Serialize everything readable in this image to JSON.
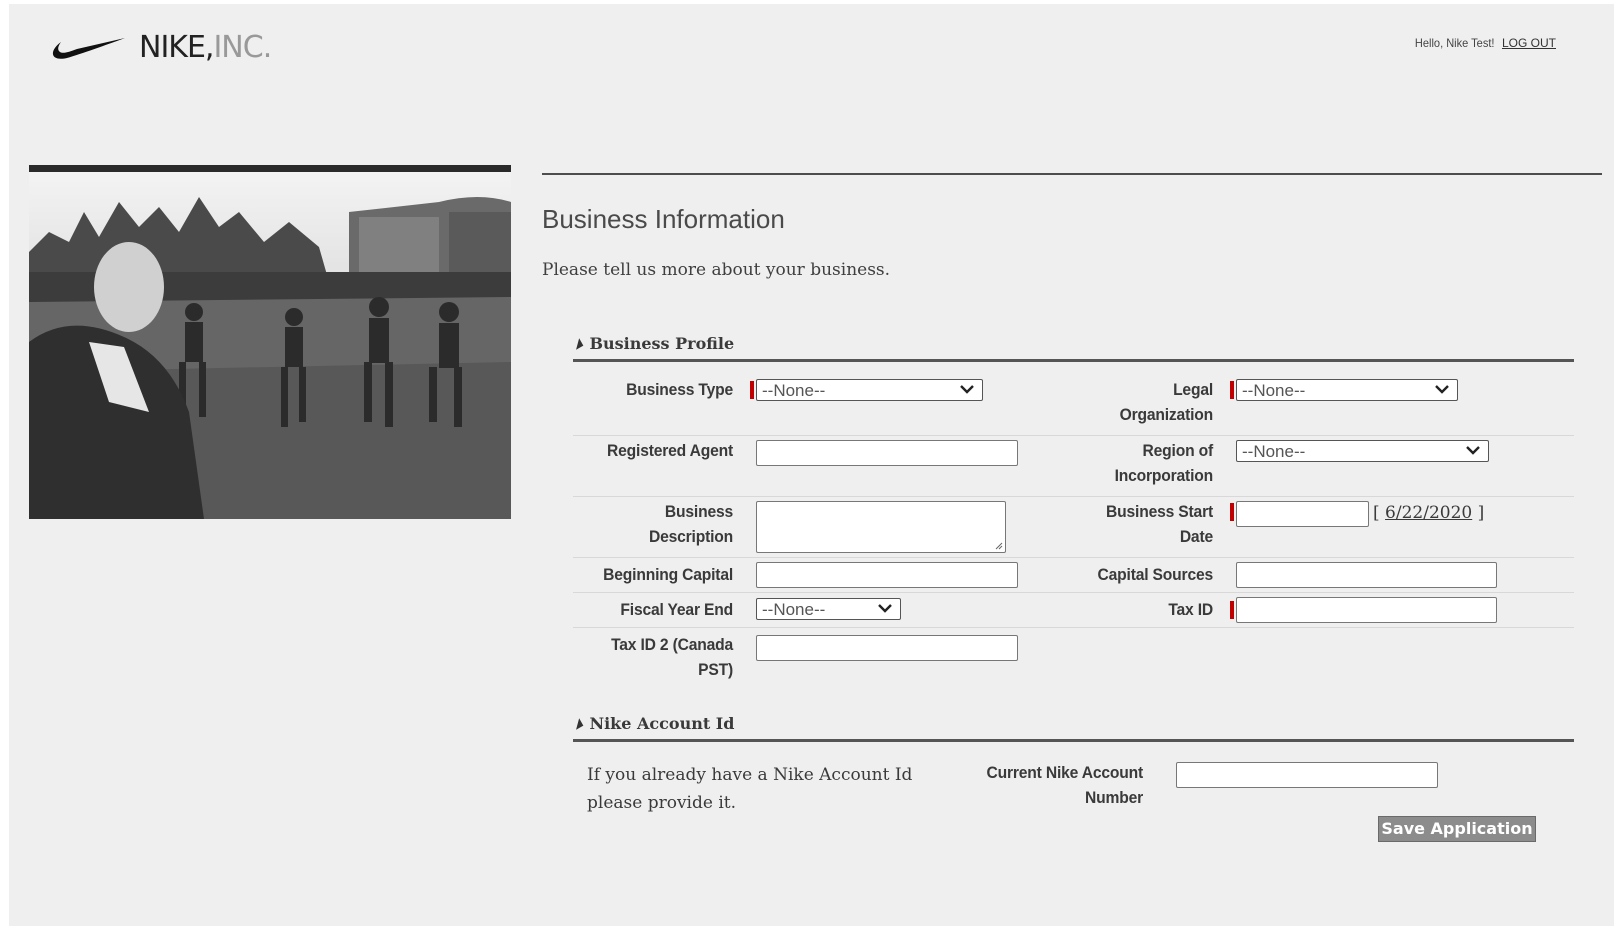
{
  "header": {
    "brand": "NIKE,",
    "brand_suffix": "INC.",
    "greeting": "Hello, Nike Test!",
    "logout_label": "LOG OUT"
  },
  "page": {
    "title": "Business Information",
    "subtitle": "Please tell us more about your business."
  },
  "sections": {
    "business_profile": "Business Profile",
    "nike_account": "Nike Account Id"
  },
  "fields": {
    "business_type": {
      "label": "Business Type",
      "value": "--None--"
    },
    "legal_org": {
      "label": "Legal Organization",
      "label_line1": "Legal",
      "label_line2": "Organization",
      "value": "--None--"
    },
    "registered_agent": {
      "label": "Registered Agent",
      "value": ""
    },
    "region": {
      "label_line1": "Region of",
      "label_line2": "Incorporation",
      "value": "--None--"
    },
    "business_desc": {
      "label_line1": "Business",
      "label_line2": "Description",
      "value": ""
    },
    "start_date": {
      "label_line1": "Business Start",
      "label_line2": "Date",
      "value": "",
      "today_link": "6/22/2020"
    },
    "beginning_capital": {
      "label": "Beginning Capital",
      "value": ""
    },
    "capital_sources": {
      "label": "Capital Sources",
      "value": ""
    },
    "fiscal_year_end": {
      "label": "Fiscal Year End",
      "value": "--None--"
    },
    "tax_id": {
      "label": "Tax ID",
      "value": ""
    },
    "tax_id2": {
      "label_line1": "Tax ID 2 (Canada",
      "label_line2": "PST)",
      "value": ""
    },
    "account_number": {
      "label_line1": "Current Nike Account",
      "label_line2": "Number",
      "value": ""
    }
  },
  "account_note": "If you already have a Nike Account Id please provide it.",
  "save_label": "Save Application",
  "colors": {
    "required": "#c00000",
    "background": "#efefef",
    "button": "#8c8c8c"
  }
}
